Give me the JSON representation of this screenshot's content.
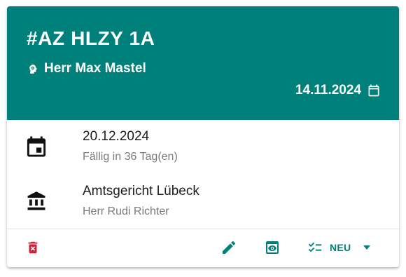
{
  "colors": {
    "header_bg": "#00807a",
    "accent": "#00807a",
    "delete": "#c8283c",
    "icon_dark": "#111111"
  },
  "header": {
    "case_number": "#AZ HLZY 1A",
    "client_name": "Herr Max Mastel",
    "client_icon": "client-head-icon",
    "created_date": "14.11.2024",
    "created_icon": "calendar-icon"
  },
  "deadline": {
    "icon": "calendar-event-icon",
    "date": "20.12.2024",
    "due_text": "Fällig in 36 Tag(en)"
  },
  "court": {
    "icon": "courthouse-icon",
    "name": "Amtsgericht Lübeck",
    "judge": "Herr Rudi Richter"
  },
  "actions": {
    "delete_icon": "delete-icon",
    "edit_icon": "pencil-icon",
    "view_icon": "eye-icon",
    "status_icon": "checklist-icon",
    "status_label": "NEU",
    "status_dropdown_icon": "caret-down-icon"
  }
}
